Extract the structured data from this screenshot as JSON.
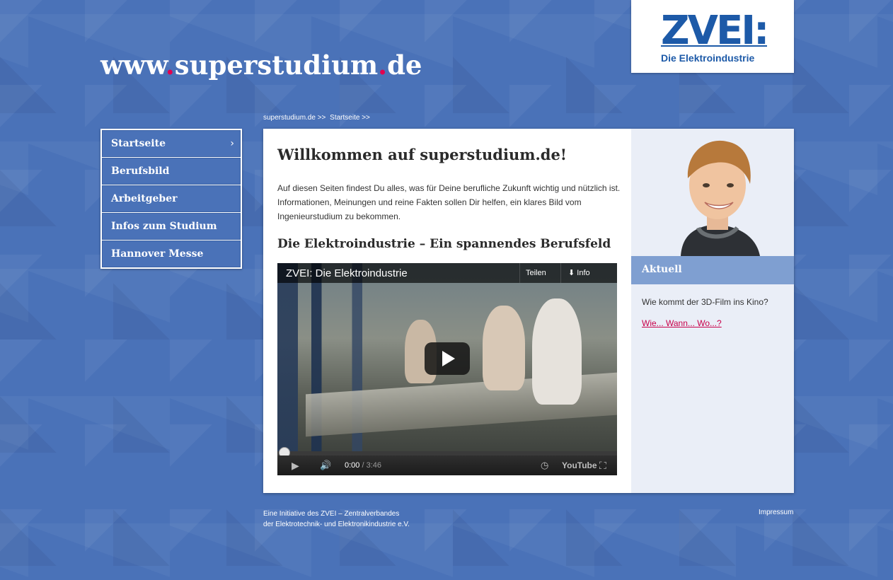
{
  "header": {
    "site_title_pre": "www",
    "site_title_dot1": ".",
    "site_title_main": "superstudium",
    "site_title_dot2": ".",
    "site_title_tld": "de",
    "logo_text": "ZVEI:",
    "logo_subtitle": "Die Elektroindustrie"
  },
  "breadcrumb": {
    "items": [
      "superstudium.de >>",
      "Startseite >>"
    ]
  },
  "nav": {
    "items": [
      {
        "label": "Startseite",
        "active": true
      },
      {
        "label": "Berufsbild"
      },
      {
        "label": "Arbeitgeber"
      },
      {
        "label": "Infos zum Studium"
      },
      {
        "label": "Hannover Messe"
      }
    ],
    "chevron": "›"
  },
  "main": {
    "title": "Willkommen auf superstudium.de!",
    "intro": "Auf diesen Seiten findest Du alles, was für Deine berufliche Zukunft wichtig und nützlich ist. Informationen, Meinungen und reine Fakten sollen Dir helfen, ein klares Bild vom Ingenieurstudium zu bekommen.",
    "subtitle": "Die Elektroindustrie – Ein spannendes Berufsfeld",
    "video": {
      "title": "ZVEI: Die Elektroindustrie",
      "share_label": "Teilen",
      "info_label": "Info",
      "current_time": "0:00",
      "duration": "/ 3:46",
      "brand": "YouTube",
      "progress": 0
    }
  },
  "sidebar": {
    "section_title": "Aktuell",
    "news_text": "Wie kommt der 3D-Film ins Kino?",
    "news_link": "Wie... Wann... Wo...?"
  },
  "footer": {
    "line1": "Eine Initiative des ZVEI – Zentralverbandes",
    "line2": "der Elektrotechnik- und Elektronikindustrie e.V.",
    "impressum": "Impressum"
  },
  "colors": {
    "background": "#4a72b8",
    "accent": "#e2004f",
    "logo_blue": "#1d5aa8",
    "aktuell_bar": "#7f9fd1"
  }
}
